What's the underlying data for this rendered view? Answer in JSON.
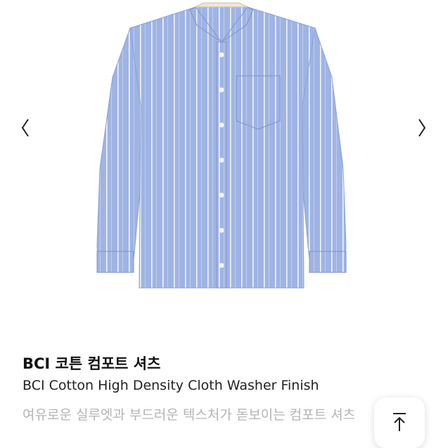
{
  "gallery": {
    "prev_icon": "chevron-left-icon",
    "next_icon": "chevron-right-icon",
    "shirt_color": "#9fb4e4",
    "stripe_color": "#ffffff"
  },
  "product": {
    "name_ko": "BCI 코튼 컴포트 셔츠",
    "name_en": "BCI Cotton High Density Cloth Washer Finish",
    "description": "여유로운 실루엣과 부드러운 텍스처가 돋보이는 컴포트 셔츠"
  },
  "scroll_top": {
    "icon": "arrow-up-to-top-icon"
  }
}
